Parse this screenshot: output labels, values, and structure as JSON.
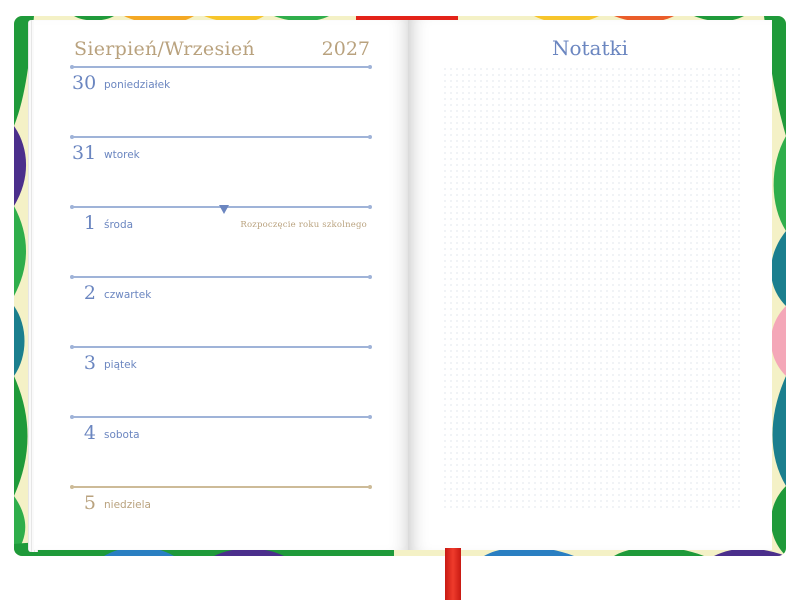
{
  "planner": {
    "month_title": "Sierpień/Wrzesień",
    "year": "2027",
    "days": [
      {
        "number": "30",
        "name": "poniedziałek",
        "note": ""
      },
      {
        "number": "31",
        "name": "wtorek",
        "note": ""
      },
      {
        "number": "1",
        "name": "środa",
        "note": "Rozpoczęcie roku szkolnego"
      },
      {
        "number": "2",
        "name": "czwartek",
        "note": ""
      },
      {
        "number": "3",
        "name": "piątek",
        "note": ""
      },
      {
        "number": "4",
        "name": "sobota",
        "note": ""
      },
      {
        "number": "5",
        "name": "niedziela",
        "note": ""
      }
    ],
    "notes_title": "Notatki"
  },
  "colors": {
    "accent_blue": "#6b86c0",
    "accent_gold": "#b9a27e",
    "ribbon_red": "#e32319",
    "cover_green": "#1f9a3a"
  }
}
